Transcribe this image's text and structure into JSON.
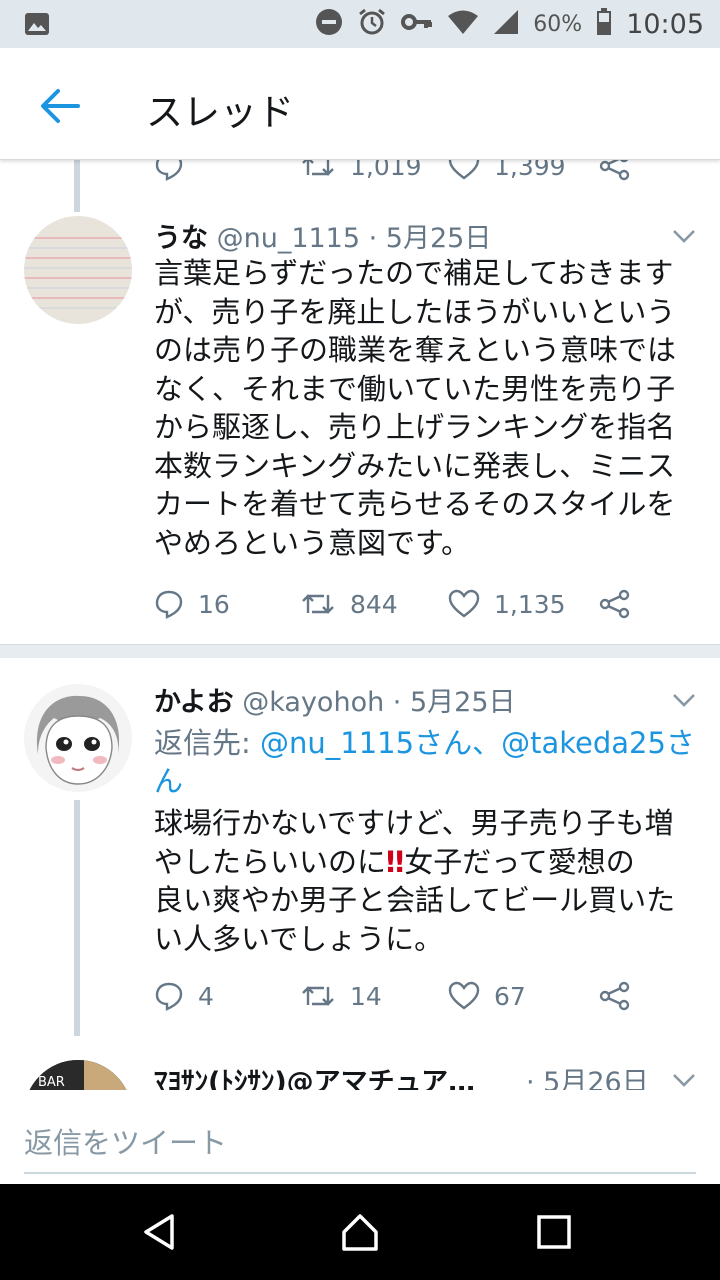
{
  "status_bar": {
    "battery": "60%",
    "time": "10:05"
  },
  "header": {
    "title": "スレッド"
  },
  "prev_tweet_actions": {
    "retweets": "1,019",
    "likes": "1,399"
  },
  "tweets": [
    {
      "name": "うな",
      "handle": "@nu_1115",
      "date": "· 5月25日",
      "body_lines": [
        "言葉足らずだったので補足しておきます",
        "が、売り子を廃止したほうがいいという",
        "のは売り子の職業を奪えという意味では",
        "なく、それまで働いていた男性を売り子",
        "から駆逐し、売り上げランキングを指名",
        "本数ランキングみたいに発表し、ミニス",
        "カートを着せて売らせるそのスタイルを",
        "やめろという意図です。"
      ],
      "replies": "16",
      "retweets": "844",
      "likes": "1,135"
    },
    {
      "name": "かよお",
      "handle": "@kayohoh",
      "date": "· 5月25日",
      "reply_prefix": "返信先: ",
      "reply_to_1": "@nu_1115さん",
      "reply_sep": "、",
      "reply_to_2a": "@takeda25さ",
      "reply_to_2b": "ん",
      "body_lines": [
        "球場行かないですけど、男子売り子も増",
        "やしたらいいのに",
        "女子だって愛想の",
        "良い爽やか男子と会話してビール買いた",
        "い人多いでしょうに。"
      ],
      "emoji": "‼",
      "replies": "4",
      "retweets": "14",
      "likes": "67"
    },
    {
      "name": "ﾏﾖｻﾝ(ﾄｼｻﾝ)@アマチュア…",
      "date": "· 5月26日",
      "avatar_text": "BAR"
    }
  ],
  "compose": {
    "placeholder": "返信をツイート"
  },
  "colors": {
    "accent": "#1b95e0",
    "muted": "#657786",
    "text": "#14171a"
  }
}
